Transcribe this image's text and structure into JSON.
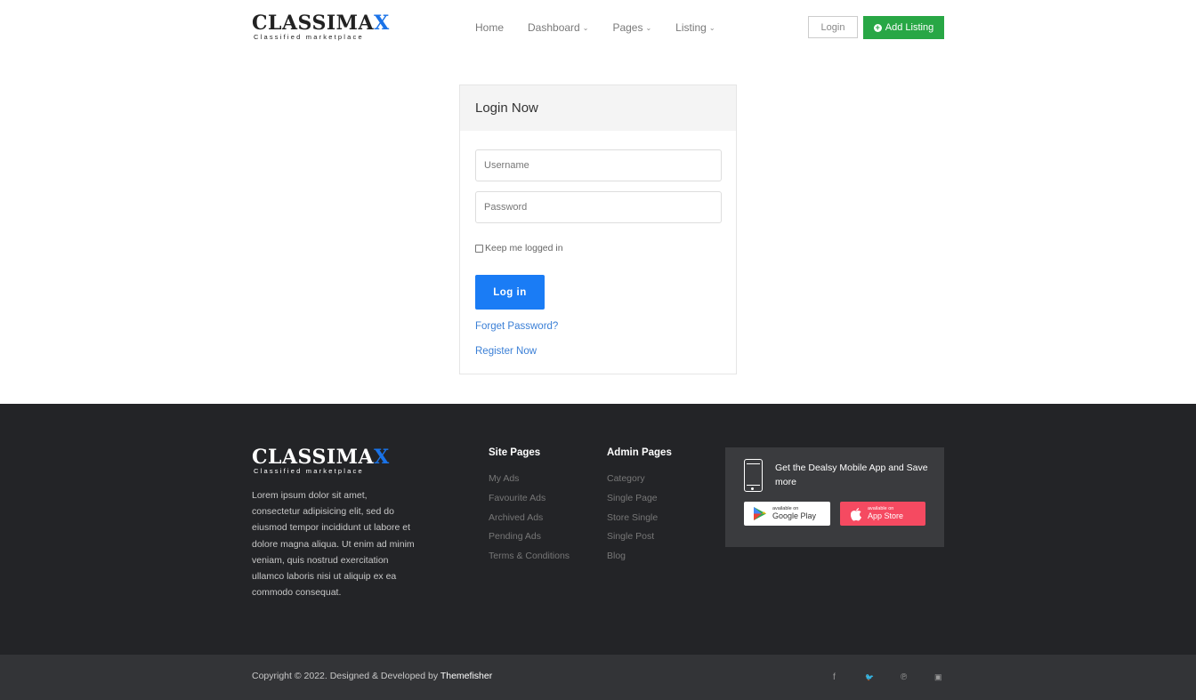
{
  "brand": {
    "name_main": "CLASSIMA",
    "name_accent": "X",
    "tagline": "Classified marketplace"
  },
  "nav": {
    "items": [
      {
        "label": "Home",
        "has_dropdown": false
      },
      {
        "label": "Dashboard",
        "has_dropdown": true
      },
      {
        "label": "Pages",
        "has_dropdown": true
      },
      {
        "label": "Listing",
        "has_dropdown": true
      }
    ],
    "login_label": "Login",
    "add_listing_label": "Add Listing"
  },
  "login": {
    "title": "Login Now",
    "username_placeholder": "Username",
    "password_placeholder": "Password",
    "remember_label": "Keep me logged in",
    "submit_label": "Log in",
    "forget_link": "Forget Password?",
    "register_link": "Register Now"
  },
  "footer": {
    "about": "Lorem ipsum dolor sit amet, consectetur adipisicing elit, sed do eiusmod tempor incididunt ut labore et dolore magna aliqua. Ut enim ad minim veniam, quis nostrud exercitation ullamco laboris nisi ut aliquip ex ea commodo consequat.",
    "site_pages": {
      "title": "Site Pages",
      "items": [
        "My Ads",
        "Favourite Ads",
        "Archived Ads",
        "Pending Ads",
        "Terms & Conditions"
      ]
    },
    "admin_pages": {
      "title": "Admin Pages",
      "items": [
        "Category",
        "Single Page",
        "Store Single",
        "Single Post",
        "Blog"
      ]
    },
    "app": {
      "text": "Get the Dealsy Mobile App and Save more",
      "google_small": "available on",
      "google_big": "Google Play",
      "apple_small": "available on",
      "apple_big": "App Store"
    },
    "copyright_prefix": "Copyright © 2022. Designed & Developed by ",
    "copyright_brand": "Themefisher",
    "social": [
      {
        "icon": "facebook-icon",
        "glyph": "f"
      },
      {
        "icon": "twitter-icon",
        "glyph": "🐦"
      },
      {
        "icon": "pinterest-icon",
        "glyph": "℗"
      },
      {
        "icon": "vimeo-icon",
        "glyph": "▣"
      }
    ]
  },
  "colors": {
    "accent": "#1a7cf5",
    "green": "#28a745",
    "footer_bg": "#232427",
    "apple_badge": "#f54a61"
  }
}
